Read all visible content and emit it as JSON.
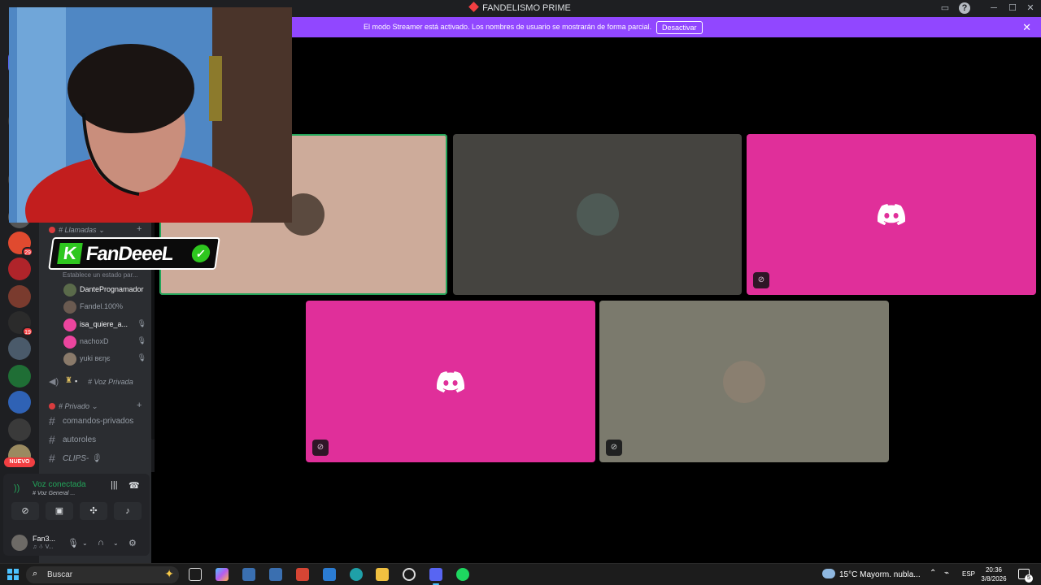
{
  "window": {
    "title": "FANDELISMO PRIME"
  },
  "banner": {
    "message": "El modo Streamer está activado. Los nombres de usuario se mostrarán de forma parcial.",
    "button": "Desactivar",
    "close": "✕"
  },
  "servers": [
    {
      "name": "server-1",
      "color": "#e04a2f",
      "badge": "29"
    },
    {
      "name": "server-2",
      "color": "#b0242a",
      "badge": ""
    },
    {
      "name": "server-3",
      "color": "#7a3b2e",
      "badge": ""
    },
    {
      "name": "server-4",
      "color": "#2b2b2b",
      "badge": "19"
    },
    {
      "name": "server-5",
      "color": "#4a5a6a",
      "badge": ""
    },
    {
      "name": "server-6",
      "color": "#1f6e35",
      "badge": ""
    },
    {
      "name": "server-7",
      "color": "#2f62b5",
      "badge": ""
    },
    {
      "name": "server-8",
      "color": "#3a3a3a",
      "badge": ""
    },
    {
      "name": "server-9",
      "color": "#9a8a60",
      "badge": ""
    }
  ],
  "nuevo_badge": "NUEVO",
  "sidebar": {
    "category_llamadas": "# Llamadas",
    "status_hint": "Establece un estado par...",
    "voice_users": [
      {
        "name": "DantePrognamador",
        "color": "#f2f3f5",
        "avatar": "#5a6a4a",
        "mute": ""
      },
      {
        "name": "Fandel.100%",
        "color": "#949ba4",
        "avatar": "#6a5a50",
        "mute": ""
      },
      {
        "name": "isa_quiere_a...",
        "color": "#f2f3f5",
        "avatar": "#eb459e",
        "mute": "🎙"
      },
      {
        "name": "nachoxD",
        "color": "#949ba4",
        "avatar": "#eb459e",
        "mute": "🎙"
      },
      {
        "name": "yuki вєηє",
        "color": "#949ba4",
        "avatar": "#8a7a6a",
        "mute": "🎙"
      }
    ],
    "voice_privada": "# Voz Privada",
    "category_privado": "# Privado",
    "text_channels": [
      {
        "name": "comandos-privados",
        "italic": false
      },
      {
        "name": "autoroles",
        "italic": false
      },
      {
        "name": "CLIPS- 🎙",
        "italic": true
      }
    ]
  },
  "voice_panel": {
    "state": "Voz conectada",
    "channel": "# Voz General ...",
    "user_name": "Fan3...",
    "user_status": "♫ ·!· V..."
  },
  "overlay": {
    "brand_k": "K",
    "brand_name": "FanDeeeL",
    "check": "✓"
  },
  "tiles": [
    {
      "name": "tile-user-1",
      "bg": "#cdab9a",
      "kind": "avatar",
      "avatar_color": "#5b4a3f",
      "mute": false,
      "speaking": true
    },
    {
      "name": "tile-user-2",
      "bg": "#454440",
      "kind": "avatar",
      "avatar_color": "#4e5a55",
      "mute": false,
      "speaking": false
    },
    {
      "name": "tile-user-3",
      "bg": "#e02f9a",
      "kind": "discord",
      "mute": true,
      "speaking": false
    },
    {
      "name": "tile-user-4",
      "bg": "#e02f9a",
      "kind": "discord",
      "mute": true,
      "speaking": false
    },
    {
      "name": "tile-user-5",
      "bg": "#7b7a6d",
      "kind": "avatar",
      "avatar_color": "#8a7f70",
      "mute": true,
      "speaking": false
    }
  ],
  "taskbar": {
    "search": "Buscar",
    "weather": "15°C  Mayorm. nubla...",
    "lang": "ESP",
    "time": "20:36",
    "date": "3/8/2026",
    "notifications": "5"
  }
}
